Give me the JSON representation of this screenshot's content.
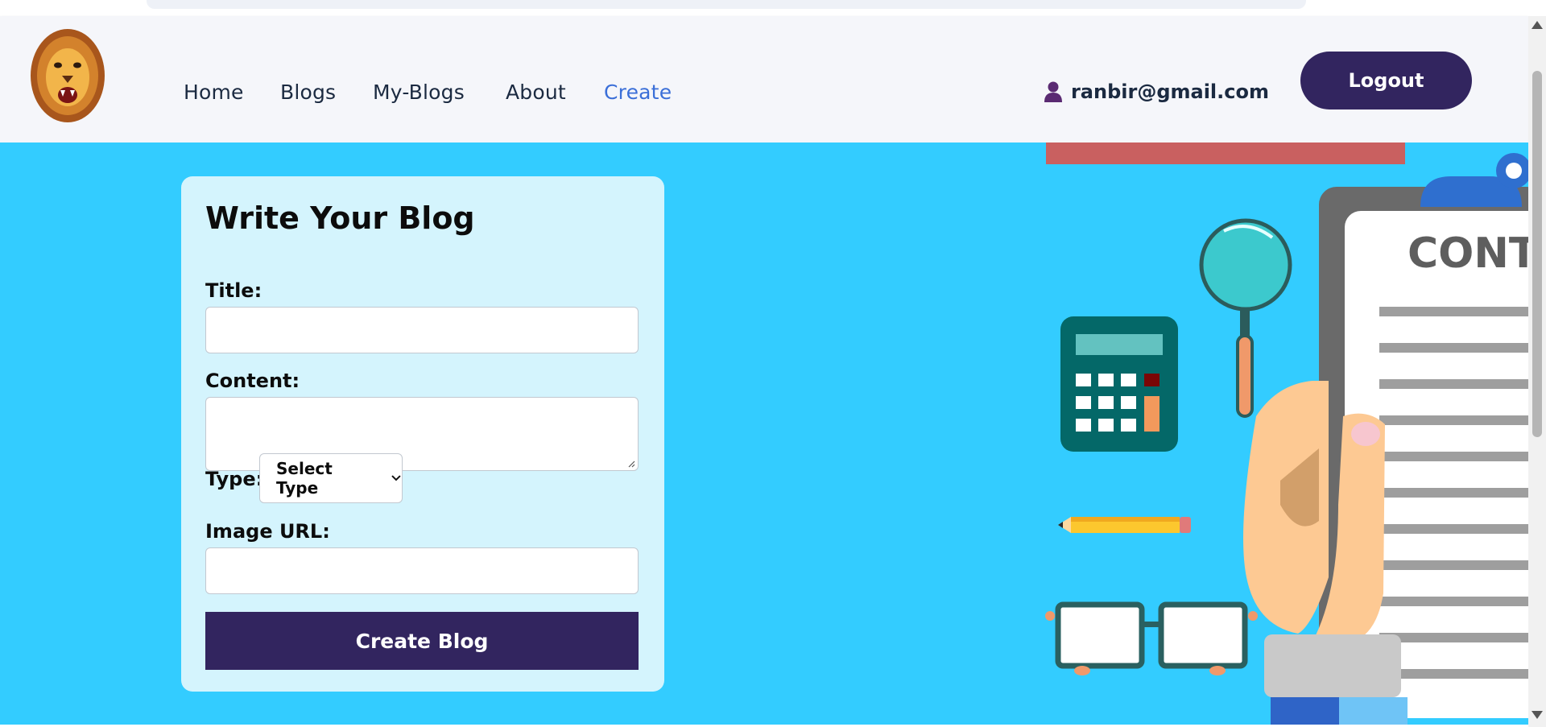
{
  "navbar": {
    "links": [
      "Home",
      "Blogs",
      "My-Blogs",
      "About",
      "Create"
    ],
    "active_link": "Create",
    "user_email": "ranbir@gmail.com",
    "logout_label": "Logout"
  },
  "form": {
    "title": "Write Your Blog",
    "title_label": "Title:",
    "title_value": "",
    "content_label": "Content:",
    "content_value": "",
    "type_label": "Type:",
    "type_selected": "Select Type",
    "image_label": "Image URL:",
    "image_value": "",
    "submit_label": "Create Blog"
  },
  "illustration": {
    "clipboard_text": "CONT"
  },
  "icons": [
    "lion-logo-icon",
    "user-icon",
    "chevron-down-icon"
  ],
  "colors": {
    "accent": "#32255f",
    "active_link": "#3b6fd8",
    "main_background": "#33ccff",
    "card_background": "#d4f4fd"
  }
}
